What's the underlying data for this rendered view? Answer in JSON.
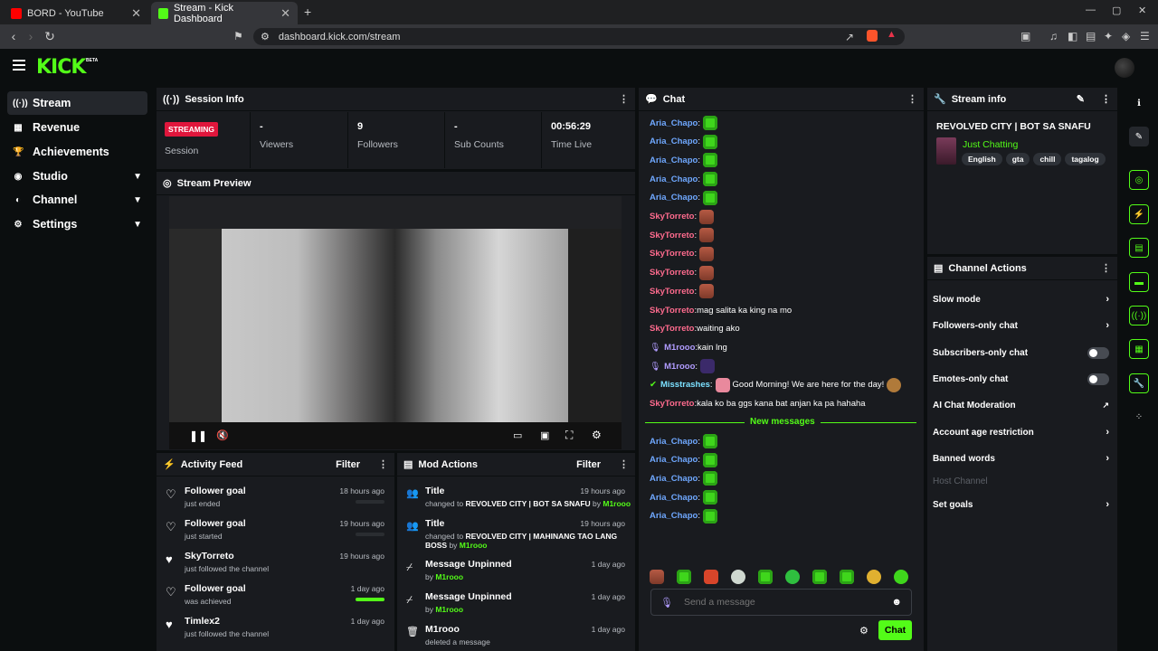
{
  "browser": {
    "tabs": [
      {
        "title": "BORD - YouTube"
      },
      {
        "title": "Stream - Kick Dashboard"
      }
    ],
    "url": "dashboard.kick.com/stream"
  },
  "brand": {
    "logo": "KICK",
    "beta": "BETA",
    "accent": "#53fc18"
  },
  "sidebar": {
    "items": [
      {
        "label": "Stream",
        "icon": "broadcast-icon"
      },
      {
        "label": "Revenue",
        "icon": "money-icon"
      },
      {
        "label": "Achievements",
        "icon": "trophy-icon"
      },
      {
        "label": "Studio",
        "icon": "studio-icon"
      },
      {
        "label": "Channel",
        "icon": "channel-icon"
      },
      {
        "label": "Settings",
        "icon": "gear-icon"
      }
    ]
  },
  "session": {
    "title": "Session Info",
    "badge": "STREAMING",
    "stats": [
      {
        "value": "",
        "label": "Session"
      },
      {
        "value": "-",
        "label": "Viewers"
      },
      {
        "value": "9",
        "label": "Followers"
      },
      {
        "value": "-",
        "label": "Sub Counts"
      },
      {
        "value": "00:56:29",
        "label": "Time Live"
      }
    ]
  },
  "preview": {
    "title": "Stream Preview"
  },
  "activity": {
    "title": "Activity Feed",
    "filter": "Filter",
    "items": [
      {
        "title": "Follower goal",
        "sub": "just ended",
        "time": "18 hours ago",
        "progress": 0
      },
      {
        "title": "Follower goal",
        "sub": "just started",
        "time": "19 hours ago",
        "progress": 0
      },
      {
        "title": "SkyTorreto",
        "sub": "just followed the channel",
        "time": "19 hours ago"
      },
      {
        "title": "Follower goal",
        "sub": "was achieved",
        "time": "1 day ago",
        "progress": 1
      },
      {
        "title": "Timlex2",
        "sub": "just followed the channel",
        "time": "1 day ago"
      }
    ]
  },
  "mod": {
    "title": "Mod Actions",
    "filter": "Filter",
    "items": [
      {
        "title": "Title",
        "pre": "changed to ",
        "target": "REVOLVED CITY | BOT SA SNAFU",
        "by": " by ",
        "user": "M1rooo",
        "time": "19 hours ago"
      },
      {
        "title": "Title",
        "pre": "changed to ",
        "target": "REVOLVED CITY | MAHINANG TAO LANG BOSS",
        "by": " by ",
        "user": "M1rooo",
        "time": "19 hours ago"
      },
      {
        "title": "Message Unpinned",
        "pre": "",
        "target": "",
        "by": "by ",
        "user": "M1rooo",
        "time": "1 day ago"
      },
      {
        "title": "Message Unpinned",
        "pre": "",
        "target": "",
        "by": "by ",
        "user": "M1rooo",
        "time": "1 day ago"
      },
      {
        "title": "M1rooo",
        "pre": "deleted a message",
        "target": "",
        "by": "",
        "user": "",
        "time": "1 day ago"
      }
    ]
  },
  "chat": {
    "title": "Chat",
    "colors": {
      "Aria_Chapo": "#6fa8ff",
      "SkyTorreto": "#ff6b8e",
      "M1rooo": "#b19cff",
      "Misstrashes": "#7ce0ff"
    },
    "messages": [
      {
        "user": "Aria_Chapo",
        "text": "",
        "emote": "green"
      },
      {
        "user": "Aria_Chapo",
        "text": "",
        "emote": "green"
      },
      {
        "user": "Aria_Chapo",
        "text": "",
        "emote": "green"
      },
      {
        "user": "Aria_Chapo",
        "text": "",
        "emote": "green"
      },
      {
        "user": "Aria_Chapo",
        "text": "",
        "emote": "green"
      },
      {
        "user": "SkyTorreto",
        "text": "",
        "emote": "skin"
      },
      {
        "user": "SkyTorreto",
        "text": "",
        "emote": "skin"
      },
      {
        "user": "SkyTorreto",
        "text": "",
        "emote": "skin"
      },
      {
        "user": "SkyTorreto",
        "text": "",
        "emote": "skin"
      },
      {
        "user": "SkyTorreto",
        "text": "",
        "emote": "skin"
      },
      {
        "user": "SkyTorreto",
        "text": "mag salita ka king na mo",
        "emote": ""
      },
      {
        "user": "SkyTorreto",
        "text": "waiting ako",
        "emote": ""
      },
      {
        "user": "M1rooo",
        "text": "kain lng",
        "emote": "",
        "badge": "mic"
      },
      {
        "user": "M1rooo",
        "text": "",
        "emote": "purple",
        "badge": "mic"
      },
      {
        "user": "Misstrashes",
        "text": "Good Morning! We are here for the day!",
        "emote": "pink",
        "badge": "verified"
      },
      {
        "user": "SkyTorreto",
        "text": "kala ko ba ggs kana bat anjan ka pa hahaha",
        "emote": ""
      }
    ],
    "divider": "New messages",
    "new_messages": [
      {
        "user": "Aria_Chapo",
        "emote": "green"
      },
      {
        "user": "Aria_Chapo",
        "emote": "green"
      },
      {
        "user": "Aria_Chapo",
        "emote": "green"
      },
      {
        "user": "Aria_Chapo",
        "emote": "green"
      },
      {
        "user": "Aria_Chapo",
        "emote": "green"
      }
    ],
    "input_placeholder": "Send a message",
    "send_label": "Chat"
  },
  "streaminfo": {
    "title": "Stream info",
    "stream_title": "REVOLVED CITY | BOT SA SNAFU",
    "category": "Just Chatting",
    "tags": [
      "English",
      "gta",
      "chill",
      "tagalog"
    ]
  },
  "actions": {
    "title": "Channel Actions",
    "items": [
      {
        "label": "Slow mode",
        "control": "arrow"
      },
      {
        "label": "Followers-only chat",
        "control": "arrow"
      },
      {
        "label": "Subscribers-only chat",
        "control": "toggle"
      },
      {
        "label": "Emotes-only chat",
        "control": "toggle"
      },
      {
        "label": "AI Chat Moderation",
        "control": "external"
      },
      {
        "label": "Account age restriction",
        "control": "arrow"
      },
      {
        "label": "Banned words",
        "control": "arrow"
      },
      {
        "label": "Host Channel",
        "control": "none",
        "disabled": true
      },
      {
        "label": "Set goals",
        "control": "arrow"
      }
    ]
  }
}
